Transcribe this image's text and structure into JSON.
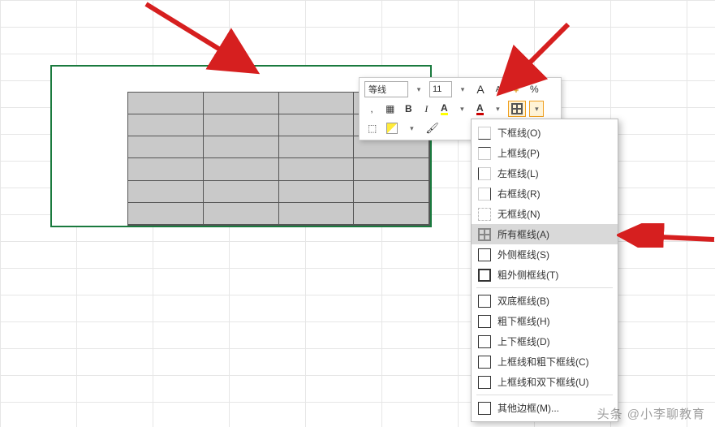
{
  "toolbar": {
    "font_name": "等线",
    "font_size": "11",
    "grow_font": "A",
    "shrink_font": "A",
    "percent": "%",
    "comma": ",",
    "bold": "B",
    "italic": "I",
    "font_color_letter": "A",
    "highlight_letter": "A"
  },
  "menu": {
    "items": [
      {
        "id": "bottom",
        "label": "下框线(O)"
      },
      {
        "id": "top",
        "label": "上框线(P)"
      },
      {
        "id": "left",
        "label": "左框线(L)"
      },
      {
        "id": "right",
        "label": "右框线(R)"
      },
      {
        "id": "none",
        "label": "无框线(N)"
      },
      {
        "id": "all",
        "label": "所有框线(A)",
        "highlight": true
      },
      {
        "id": "outside",
        "label": "外侧框线(S)"
      },
      {
        "id": "thick",
        "label": "粗外侧框线(T)"
      },
      {
        "sep": true
      },
      {
        "id": "dblbottom",
        "label": "双底框线(B)"
      },
      {
        "id": "thickbottom",
        "label": "粗下框线(H)"
      },
      {
        "id": "topbottom",
        "label": "上下框线(D)"
      },
      {
        "id": "topthickbottom",
        "label": "上框线和粗下框线(C)"
      },
      {
        "id": "topdblbottom",
        "label": "上框线和双下框线(U)"
      },
      {
        "sep": true
      },
      {
        "id": "more",
        "label": "其他边框(M)..."
      }
    ]
  },
  "watermark": "头条 @小李聊教育"
}
